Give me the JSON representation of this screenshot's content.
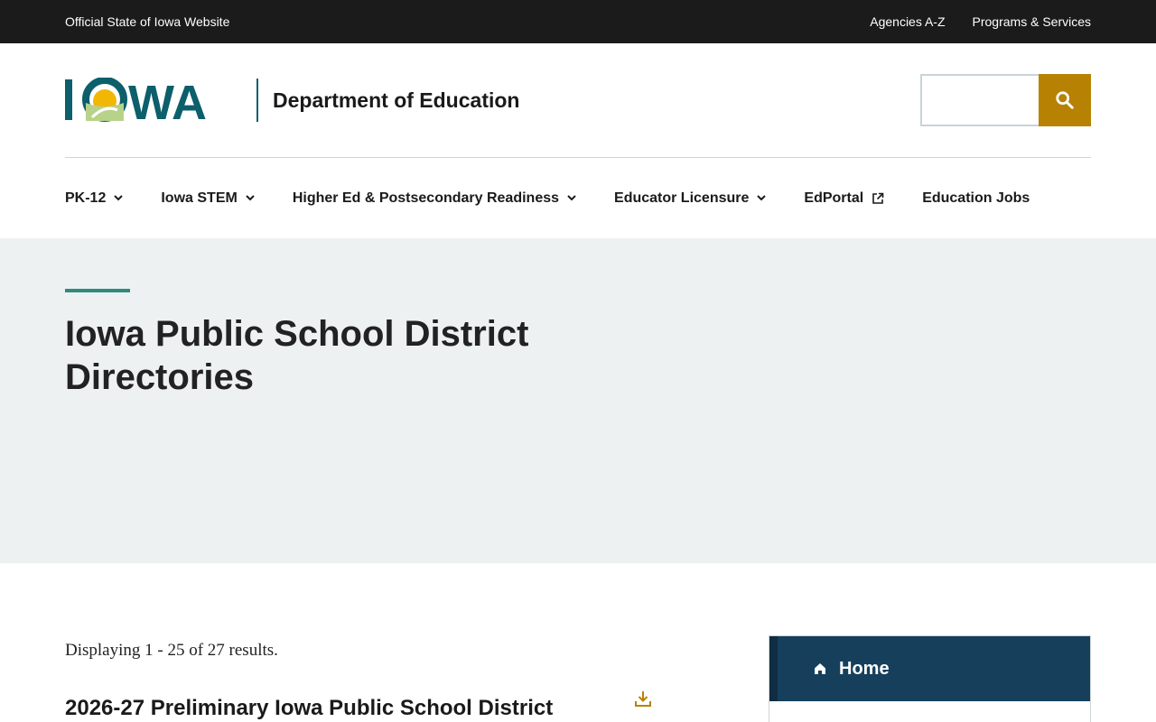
{
  "topbar": {
    "official": "Official State of Iowa Website",
    "links": [
      "Agencies A-Z",
      "Programs & Services"
    ]
  },
  "header": {
    "logo_text": "IOWA",
    "department": "Department of Education",
    "search_icon": "search-icon",
    "colors": {
      "accent": "#b78204",
      "logo_teal": "#0c5f6b",
      "logo_sun": "#f2b705",
      "logo_green": "#b8d28a"
    }
  },
  "nav": {
    "items": [
      {
        "label": "PK-12",
        "icon": "chevron-down-icon"
      },
      {
        "label": "Iowa STEM",
        "icon": "chevron-down-icon"
      },
      {
        "label": "Higher Ed & Postsecondary Readiness",
        "icon": "chevron-down-icon"
      },
      {
        "label": "Educator Licensure",
        "icon": "chevron-down-icon"
      },
      {
        "label": "EdPortal",
        "icon": "external-link-icon"
      },
      {
        "label": "Education Jobs"
      }
    ]
  },
  "hero": {
    "title": "Iowa Public School District Directories"
  },
  "main": {
    "results": "Displaying 1 - 25 of 27 results.",
    "entries": [
      {
        "title": "2026-27 Preliminary Iowa Public School District",
        "icon": "download-icon"
      }
    ]
  },
  "sidebar": {
    "home_label": "Home",
    "home_icon": "home-icon",
    "colors": {
      "bg": "#163f5c"
    }
  }
}
